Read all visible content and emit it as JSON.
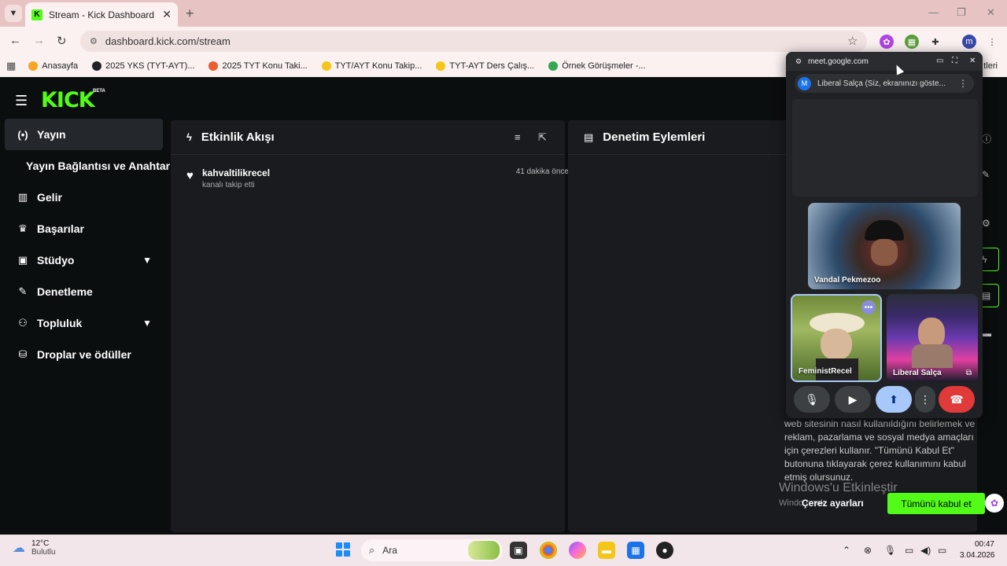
{
  "browser": {
    "tab_title": "Stream - Kick Dashboard",
    "url": "dashboard.kick.com/stream",
    "bookmarks": [
      {
        "label": "Anasayfa",
        "color": "#f6a623"
      },
      {
        "label": "2025 YKS (TYT-AYT)...",
        "color": "#222222"
      },
      {
        "label": "2025 TYT Konu Taki...",
        "color": "#e85d2f"
      },
      {
        "label": "TYT/AYT Konu Takip...",
        "color": "#f5c518"
      },
      {
        "label": "TYT-AYT Ders Çalış...",
        "color": "#f5c518"
      },
      {
        "label": "Örnek Görüşmeler -...",
        "color": "#34a853"
      }
    ],
    "bookmarks_right": "tleri"
  },
  "kick": {
    "logo": "KICK",
    "beta": "BETA",
    "sidebar": [
      {
        "label": "Yayın",
        "icon": "broadcast-icon",
        "glyph": "(•)",
        "active": true
      },
      {
        "label": "Gelir",
        "icon": "chart-icon",
        "glyph": "▥"
      },
      {
        "label": "Başarılar",
        "icon": "trophy-icon",
        "glyph": "🏆"
      },
      {
        "label": "Stüdyo",
        "icon": "studio-icon",
        "glyph": "▣",
        "expandable": true
      },
      {
        "label": "Denetleme",
        "icon": "wrench-icon",
        "glyph": "✎"
      },
      {
        "label": "Topluluk",
        "icon": "community-icon",
        "glyph": "👥",
        "expandable": true
      },
      {
        "label": "Droplar ve ödüller",
        "icon": "drops-icon",
        "glyph": "⛁"
      }
    ],
    "sidebar_sub": "Yayın Bağlantısı ve Anahtarı",
    "activity_panel": {
      "title": "Etkinlik Akışı",
      "items": [
        {
          "user": "kahvaltilikrecel",
          "action": "kanalı takip etti",
          "time": "41 dakika önce"
        }
      ]
    },
    "moderation_panel": {
      "title": "Denetim Eylemleri"
    },
    "cookie": {
      "text": "web sitesinin nasıl kullanıldığını belirlemek ve reklam, pazarlama ve sosyal medya amaçları için çerezleri kullanır. \"Tümünü Kabul Et\" butonuna tıklayarak çerez kullanımını kabul etmiş olursunuz.",
      "settings": "Çerez ayarları",
      "accept": "Tümünü kabul et"
    },
    "windows_watermark": "Windows'u Etkinleştir",
    "windows_watermark_sub": "Windo        rmek"
  },
  "meet": {
    "domain": "meet.google.com",
    "presenting": "Liberal Salça (Siz, ekranınızı göste...",
    "avatar_letter": "M",
    "participants": [
      {
        "name": "Vandal Pekmezoo"
      },
      {
        "name": "FeministRecel"
      },
      {
        "name": "Liberal Salça"
      }
    ]
  },
  "taskbar": {
    "temp": "12°C",
    "condition": "Bulutlu",
    "search": "Ara",
    "time": "00:47",
    "date": "3.04.2026"
  },
  "colors": {
    "kick_green": "#53fc18",
    "end_call": "#e03a3a",
    "share_active": "#a8c7fa"
  }
}
